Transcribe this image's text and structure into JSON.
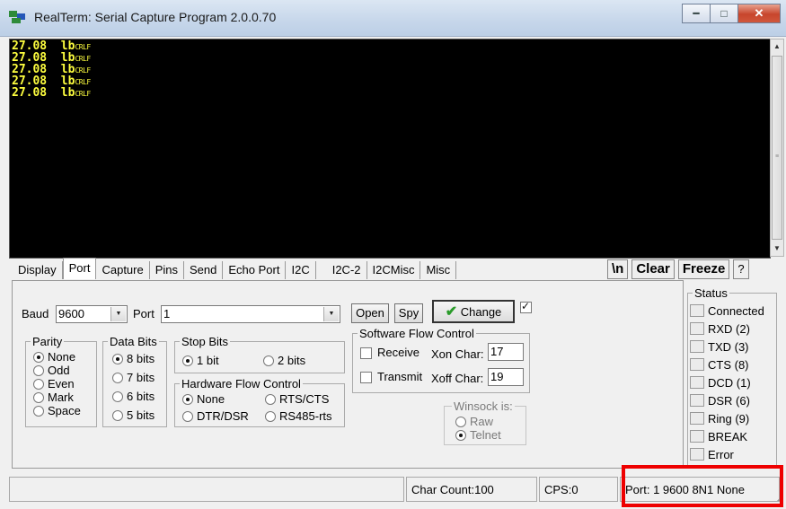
{
  "window": {
    "title": "RealTerm: Serial Capture Program 2.0.0.70"
  },
  "terminal": {
    "lines": [
      {
        "value": "27.08",
        "unit": "lb",
        "ctl": "CRLF"
      },
      {
        "value": "27.08",
        "unit": "lb",
        "ctl": "CRLF"
      },
      {
        "value": "27.08",
        "unit": "lb",
        "ctl": "CRLF"
      },
      {
        "value": "27.08",
        "unit": "lb",
        "ctl": "CRLF"
      },
      {
        "value": "27.08",
        "unit": "lb",
        "ctl": "CRLF"
      }
    ]
  },
  "tabs": [
    "Display",
    "Port",
    "Capture",
    "Pins",
    "Send",
    "Echo Port",
    "I2C",
    "I2C-2",
    "I2CMisc",
    "Misc"
  ],
  "tools": {
    "newline": "\\n",
    "clear": "Clear",
    "freeze": "Freeze",
    "help": "?"
  },
  "port": {
    "baud_label": "Baud",
    "baud_value": "9600",
    "port_label": "Port",
    "port_value": "1",
    "open": "Open",
    "spy": "Spy",
    "change": "Change",
    "parity": {
      "label": "Parity",
      "options": [
        "None",
        "Odd",
        "Even",
        "Mark",
        "Space"
      ]
    },
    "data_bits": {
      "label": "Data Bits",
      "options": [
        "8 bits",
        "7 bits",
        "6 bits",
        "5 bits"
      ]
    },
    "stop_bits": {
      "label": "Stop Bits",
      "options": [
        "1 bit",
        "2 bits"
      ]
    },
    "hw_flow": {
      "label": "Hardware Flow Control",
      "options": [
        "None",
        "RTS/CTS",
        "DTR/DSR",
        "RS485-rts"
      ]
    },
    "sw_flow": {
      "label": "Software Flow Control",
      "receive": "Receive",
      "transmit": "Transmit",
      "xon_label": "Xon Char:",
      "xon_value": "17",
      "xoff_label": "Xoff Char:",
      "xoff_value": "19"
    },
    "winsock": {
      "label": "Winsock is:",
      "options": [
        "Raw",
        "Telnet"
      ]
    }
  },
  "status": {
    "label": "Status",
    "items": [
      "Connected",
      "RXD (2)",
      "TXD (3)",
      "CTS (8)",
      "DCD (1)",
      "DSR (6)",
      "Ring (9)",
      "BREAK",
      "Error"
    ]
  },
  "statusbar": {
    "char_count": "Char Count:100",
    "cps": "CPS:0",
    "port_info": "Port: 1 9600 8N1 None"
  },
  "colors": {
    "terminal_text": "#ffff3f",
    "terminal_bg": "#000000",
    "highlight": "#ee0000"
  }
}
